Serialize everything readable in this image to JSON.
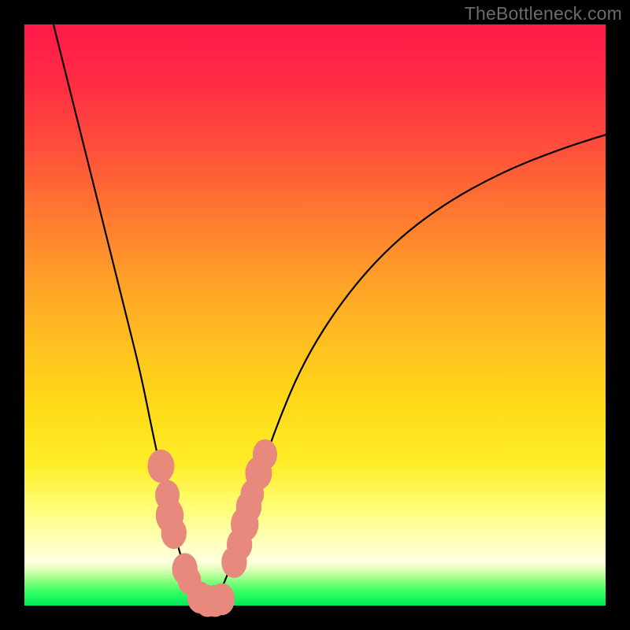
{
  "watermark": "TheBottleneck.com",
  "chart_data": {
    "type": "line",
    "title": "",
    "xlabel": "",
    "ylabel": "",
    "xlim": [
      0,
      100
    ],
    "ylim": [
      0,
      100
    ],
    "grid": false,
    "legend": false,
    "series": [
      {
        "name": "bottleneck-curve",
        "x": [
          5,
          8,
          11,
          14,
          17,
          20,
          22,
          24,
          25.5,
          27,
          28.5,
          30,
          31,
          32,
          33,
          34,
          36,
          39,
          43,
          48,
          55,
          63,
          72,
          82,
          92,
          100
        ],
        "y": [
          100,
          88,
          76,
          64,
          52,
          40,
          30,
          21,
          14,
          8,
          4,
          1.5,
          0.8,
          0.6,
          1.2,
          3,
          8,
          18,
          30,
          42,
          53,
          62,
          69,
          74.5,
          78.5,
          81
        ]
      }
    ],
    "markers": {
      "name": "highlighted-points",
      "color": "#e8897d",
      "points": [
        {
          "x": 23.5,
          "y": 24,
          "r": 2.3
        },
        {
          "x": 24.6,
          "y": 19,
          "r": 2.1
        },
        {
          "x": 25.0,
          "y": 15.5,
          "r": 2.4
        },
        {
          "x": 25.7,
          "y": 12.5,
          "r": 2.2
        },
        {
          "x": 27.6,
          "y": 6.3,
          "r": 2.2
        },
        {
          "x": 28.4,
          "y": 4.3,
          "r": 2.0
        },
        {
          "x": 30.2,
          "y": 1.4,
          "r": 2.2
        },
        {
          "x": 31.5,
          "y": 0.8,
          "r": 2.2
        },
        {
          "x": 32.8,
          "y": 0.8,
          "r": 2.2
        },
        {
          "x": 34.0,
          "y": 1.1,
          "r": 2.2
        },
        {
          "x": 36.1,
          "y": 7.5,
          "r": 2.2
        },
        {
          "x": 37.0,
          "y": 10.5,
          "r": 2.2
        },
        {
          "x": 37.9,
          "y": 14.0,
          "r": 2.4
        },
        {
          "x": 38.6,
          "y": 17.0,
          "r": 2.2
        },
        {
          "x": 39.2,
          "y": 19.2,
          "r": 2.0
        },
        {
          "x": 40.3,
          "y": 22.8,
          "r": 2.3
        },
        {
          "x": 41.4,
          "y": 26.0,
          "r": 2.1
        }
      ]
    },
    "gradient_stops": [
      {
        "pos": 0.0,
        "color": "#ff1a4a"
      },
      {
        "pos": 0.33,
        "color": "#ff7a30"
      },
      {
        "pos": 0.66,
        "color": "#ffdb18"
      },
      {
        "pos": 0.9,
        "color": "#ffffdd"
      },
      {
        "pos": 1.0,
        "color": "#00e85a"
      }
    ]
  }
}
